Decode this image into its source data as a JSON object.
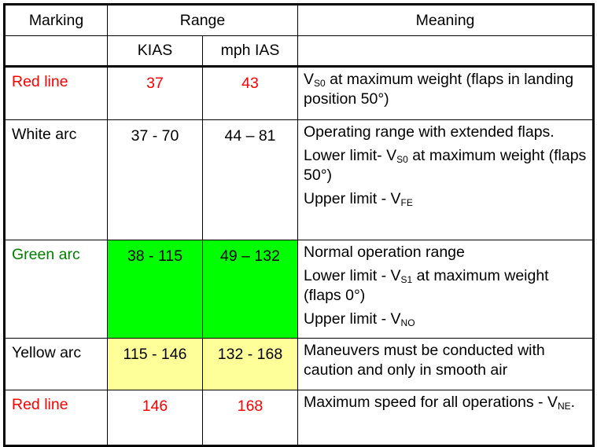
{
  "table": {
    "headers": {
      "marking": "Marking",
      "range": "Range",
      "meaning": "Meaning",
      "kias": "KIAS",
      "mph": "mph IAS"
    },
    "colors": {
      "red": "#ff0000",
      "green_text": "#008000",
      "green_fill": "#00ff00",
      "yellow_fill": "#ffff99"
    },
    "rows": [
      {
        "marking": "Red line",
        "kias": "37",
        "mph": "43",
        "meaning": [
          {
            "pre": "V",
            "sub": "S0",
            "post": " at maximum weight (flaps in landing position 50°)"
          }
        ]
      },
      {
        "marking": "White arc",
        "kias": "37 - 70",
        "mph": "44 – 81",
        "meaning": [
          {
            "pre": "Operating range with extended flaps.",
            "sub": "",
            "post": ""
          },
          {
            "pre": "Lower limit- V",
            "sub": "S0",
            "post": " at maximum weight (flaps 50°)"
          },
          {
            "pre": "Upper limit - V",
            "sub": "FE",
            "post": ""
          }
        ]
      },
      {
        "marking": "Green arc",
        "kias": "38 - 115",
        "mph": "49 – 132",
        "meaning": [
          {
            "pre": "Normal operation range",
            "sub": "",
            "post": ""
          },
          {
            "pre": "Lower limit - V",
            "sub": "S1",
            "post": " at maximum weight (flaps 0°)"
          },
          {
            "pre": "Upper limit - V",
            "sub": "NO",
            "post": ""
          }
        ]
      },
      {
        "marking": "Yellow arc",
        "kias": "115 - 146",
        "mph": "132 - 168",
        "meaning": [
          {
            "pre": "Maneuvers must be conducted with caution and only in smooth air",
            "sub": "",
            "post": ""
          }
        ]
      },
      {
        "marking": "Red line",
        "kias": "146",
        "mph": "168",
        "meaning": [
          {
            "pre": "Maximum speed for all operations - V",
            "sub": "NE",
            "post": "."
          }
        ]
      }
    ]
  }
}
